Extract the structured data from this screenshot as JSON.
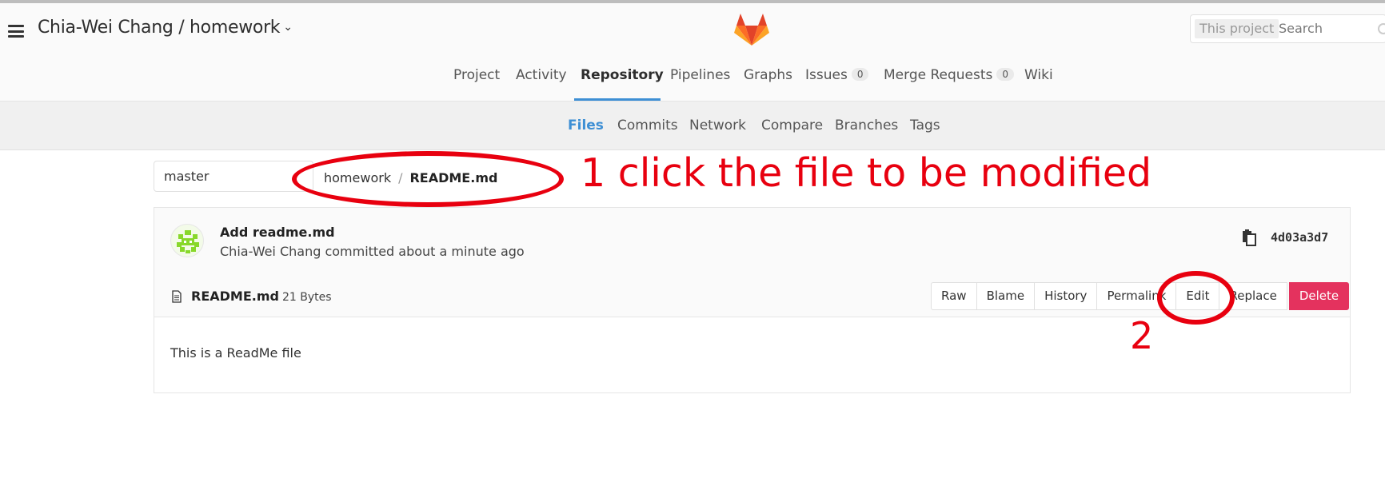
{
  "header": {
    "project_title": "Chia-Wei Chang / homework",
    "search_scope": "This project",
    "search_placeholder": "Search"
  },
  "main_nav": {
    "items": [
      "Project",
      "Activity",
      "Repository",
      "Pipelines",
      "Graphs",
      "Issues",
      "Merge Requests",
      "Wiki"
    ],
    "active": "Repository",
    "issues_count": "0",
    "merge_requests_count": "0"
  },
  "sub_nav": {
    "items": [
      "Files",
      "Commits",
      "Network",
      "Compare",
      "Branches",
      "Tags"
    ],
    "active": "Files"
  },
  "branch": "master",
  "breadcrumb": {
    "project": "homework",
    "separator": "/",
    "file": "README.md"
  },
  "annotations": {
    "step1": "1 click the file to be modified",
    "step2": "2",
    "color": "#e8000f"
  },
  "commit": {
    "title": "Add readme.md",
    "meta": "Chia-Wei Chang committed about a minute ago",
    "sha": "4d03a3d7"
  },
  "file": {
    "name": "README.md",
    "size": "21 Bytes",
    "actions": [
      "Raw",
      "Blame",
      "History",
      "Permalink",
      "Edit",
      "Replace",
      "Delete"
    ],
    "content": "This is a ReadMe file"
  },
  "colors": {
    "accent": "#3e8fd4",
    "delete": "#e4325e"
  }
}
